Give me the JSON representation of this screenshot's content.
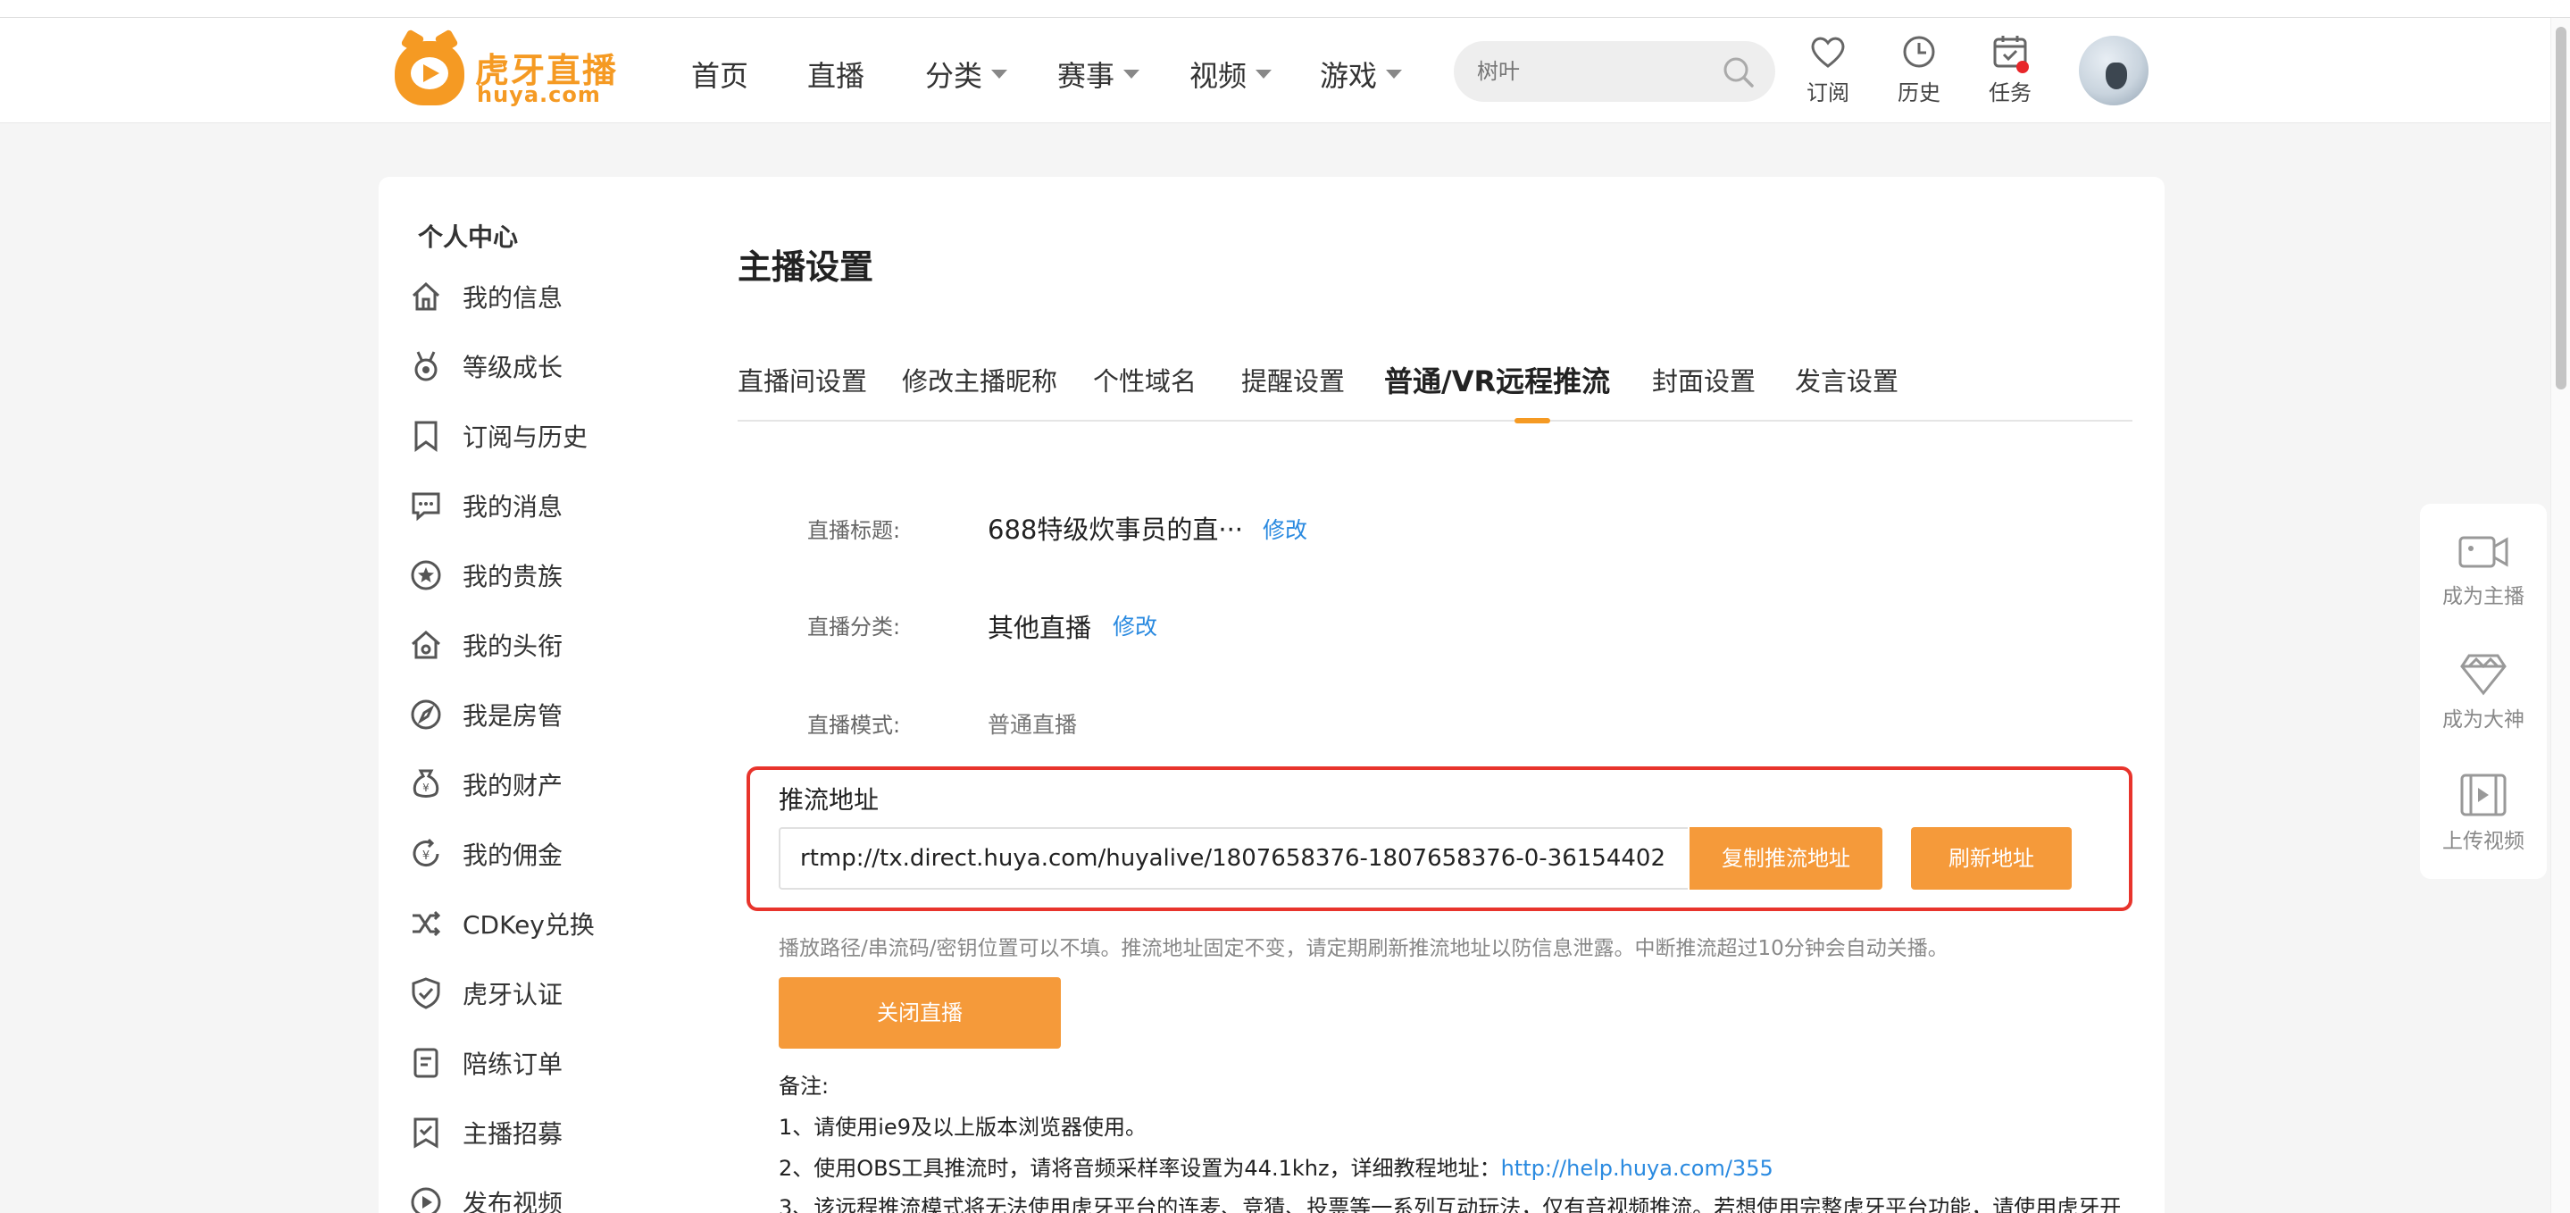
{
  "brand": {
    "name": "虎牙直播",
    "domain": "huya.com",
    "accent": "#f59a23"
  },
  "nav": {
    "items": [
      {
        "label": "首页",
        "dropdown": false
      },
      {
        "label": "直播",
        "dropdown": false
      },
      {
        "label": "分类",
        "dropdown": true
      },
      {
        "label": "赛事",
        "dropdown": true
      },
      {
        "label": "视频",
        "dropdown": true
      },
      {
        "label": "游戏",
        "dropdown": true
      }
    ]
  },
  "search": {
    "placeholder": "树叶",
    "icon": "search-icon"
  },
  "header_actions": [
    {
      "label": "订阅",
      "icon": "heart-icon"
    },
    {
      "label": "历史",
      "icon": "clock-icon"
    },
    {
      "label": "任务",
      "icon": "calendar-icon",
      "badge": true
    }
  ],
  "sidebar": {
    "title": "个人中心",
    "items": [
      {
        "label": "我的信息",
        "icon": "home-icon"
      },
      {
        "label": "等级成长",
        "icon": "medal-icon"
      },
      {
        "label": "订阅与历史",
        "icon": "bookmark-icon"
      },
      {
        "label": "我的消息",
        "icon": "message-icon"
      },
      {
        "label": "我的贵族",
        "icon": "star-circle-icon"
      },
      {
        "label": "我的头衔",
        "icon": "house-badge-icon"
      },
      {
        "label": "我是房管",
        "icon": "compass-icon"
      },
      {
        "label": "我的财产",
        "icon": "money-bag-icon"
      },
      {
        "label": "我的佣金",
        "icon": "coin-refresh-icon"
      },
      {
        "label": "CDKey兑换",
        "icon": "shuffle-icon"
      },
      {
        "label": "虎牙认证",
        "icon": "shield-check-icon"
      },
      {
        "label": "陪练订单",
        "icon": "order-icon"
      },
      {
        "label": "主播招募",
        "icon": "flag-icon"
      },
      {
        "label": "发布视频",
        "icon": "play-circle-icon"
      }
    ]
  },
  "main": {
    "title": "主播设置",
    "tabs": [
      {
        "label": "直播间设置",
        "active": false
      },
      {
        "label": "修改主播昵称",
        "active": false
      },
      {
        "label": "个性域名",
        "active": false
      },
      {
        "label": "提醒设置",
        "active": false
      },
      {
        "label": "普通/VR远程推流",
        "active": true
      },
      {
        "label": "封面设置",
        "active": false
      },
      {
        "label": "发言设置",
        "active": false
      }
    ],
    "fields": {
      "title_label": "直播标题:",
      "title_value": "688特级炊事员的直···",
      "title_edit": "修改",
      "category_label": "直播分类:",
      "category_value": "其他直播",
      "category_edit": "修改",
      "mode_label": "直播模式:",
      "mode_value": "普通直播"
    },
    "push": {
      "title": "推流地址",
      "url": "rtmp://tx.direct.huya.com/huyalive/1807658376-1807658376-0-36154402",
      "copy_label": "复制推流地址",
      "refresh_label": "刷新地址",
      "hint": "播放路径/串流码/密钥位置可以不填。推流地址固定不变，请定期刷新推流地址以防信息泄露。中断推流超过10分钟会自动关播。",
      "close_label": "关闭直播"
    },
    "notes": {
      "title": "备注:",
      "items": [
        {
          "text": "1、请使用ie9及以上版本浏览器使用。"
        },
        {
          "text": "2、使用OBS工具推流时，请将音频采样率设置为44.1khz，详细教程地址：",
          "link": "http://help.huya.com/355"
        },
        {
          "text": "3、该远程推流模式将无法使用虎牙平台的连麦、竞猜、投票等一系列互动玩法，仅有音视频推流。若想使用完整虎牙平台功能，请使用虎牙开"
        }
      ]
    }
  },
  "float_panel": [
    {
      "label": "成为主播",
      "icon": "camera-icon"
    },
    {
      "label": "成为大神",
      "icon": "diamond-icon"
    },
    {
      "label": "上传视频",
      "icon": "film-icon"
    }
  ],
  "colors": {
    "accent": "#f59a23",
    "button": "#f59a3a",
    "highlight_border": "#e8342c",
    "link": "#2a8ae0",
    "badge": "#e8262a"
  }
}
